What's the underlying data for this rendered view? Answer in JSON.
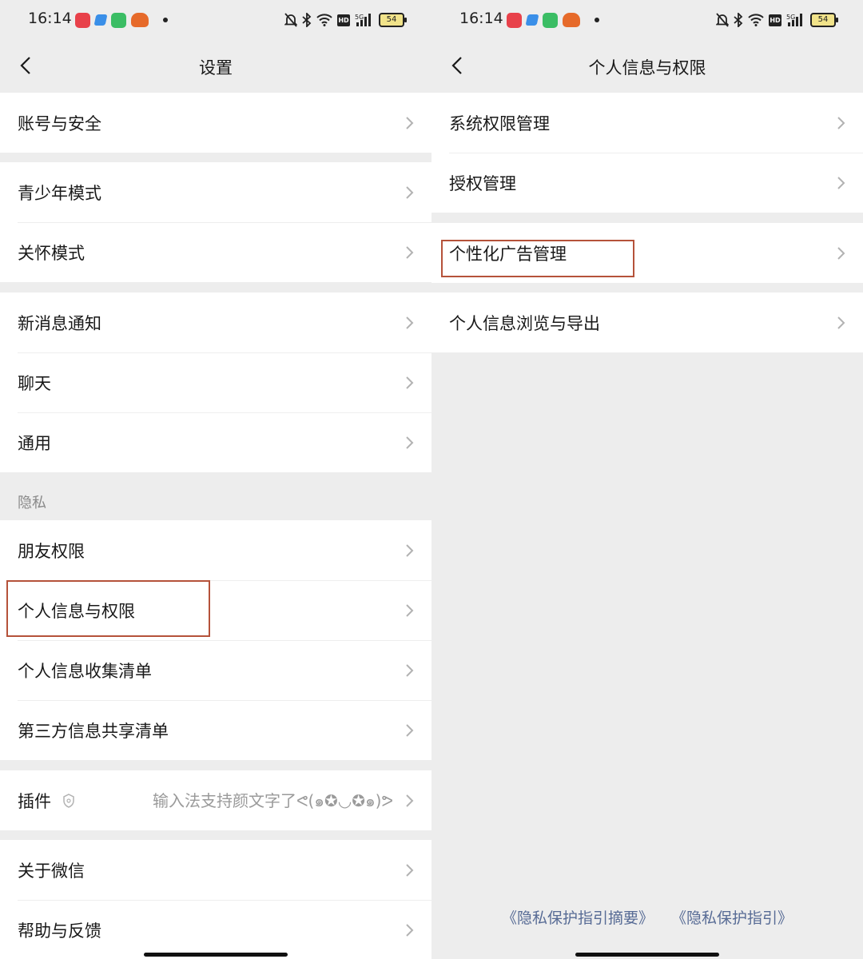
{
  "status_bar": {
    "time": "16:14",
    "network": "5G",
    "battery": "54",
    "hd": "HD"
  },
  "left": {
    "title": "设置",
    "groups": [
      [
        "账号与安全"
      ],
      [
        "青少年模式",
        "关怀模式"
      ],
      [
        "新消息通知",
        "聊天",
        "通用"
      ]
    ],
    "privacy_header": "隐私",
    "privacy_items": [
      "朋友权限",
      "个人信息与权限",
      "个人信息收集清单",
      "第三方信息共享清单"
    ],
    "plugin": {
      "label": "插件",
      "description": "输入法支持颜文字了ᕙ(๑✪◡✪๑)ᕗ"
    },
    "bottom_items": [
      "关于微信",
      "帮助与反馈"
    ]
  },
  "right": {
    "title": "个人信息与权限",
    "groups": [
      [
        "系统权限管理",
        "授权管理"
      ],
      [
        "个性化广告管理"
      ],
      [
        "个人信息浏览与导出"
      ]
    ],
    "footer_links": [
      "《隐私保护指引摘要》",
      "《隐私保护指引》"
    ]
  },
  "colors": {
    "highlight": "#b5523a",
    "link": "#576b95",
    "background": "#ededed"
  }
}
